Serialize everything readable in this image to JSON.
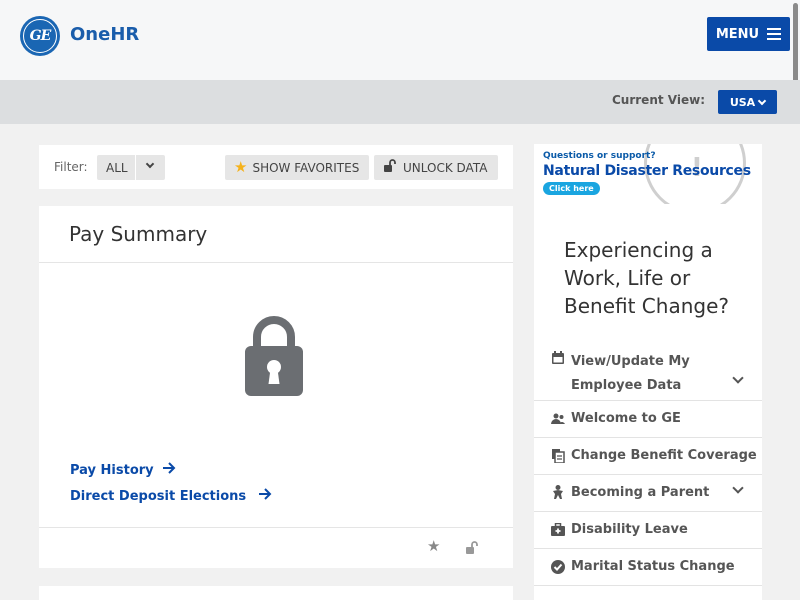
{
  "header": {
    "logo_text": "GE",
    "brand": "OneHR",
    "menu_label": "MENU"
  },
  "view": {
    "label": "Current View:",
    "selected": "USA"
  },
  "filter": {
    "label": "Filter:",
    "selected": "ALL",
    "show_favorites": "SHOW FAVORITES",
    "unlock_data": "UNLOCK DATA"
  },
  "pay_card": {
    "title": "Pay Summary",
    "links": [
      "Pay History",
      "Direct Deposit Elections"
    ]
  },
  "banner": {
    "question": "Questions or support?",
    "title": "Natural Disaster Resources",
    "cta": "Click here"
  },
  "life_change": {
    "title": "Experiencing a Work, Life or Benefit Change?",
    "items": [
      {
        "label": "View/Update My Employee Data",
        "icon": "calendar-icon",
        "expandable": true
      },
      {
        "label": "Welcome to GE",
        "icon": "users-icon",
        "expandable": false
      },
      {
        "label": "Change Benefit Coverage",
        "icon": "documents-icon",
        "expandable": false
      },
      {
        "label": "Becoming a Parent",
        "icon": "baby-icon",
        "expandable": true
      },
      {
        "label": "Disability Leave",
        "icon": "medical-kit-icon",
        "expandable": false
      },
      {
        "label": "Marital Status Change",
        "icon": "check-circle-icon",
        "expandable": false
      }
    ]
  },
  "colors": {
    "primary": "#0a4aa8",
    "star": "#f5b21b",
    "banner_cta": "#1aa5e0"
  }
}
